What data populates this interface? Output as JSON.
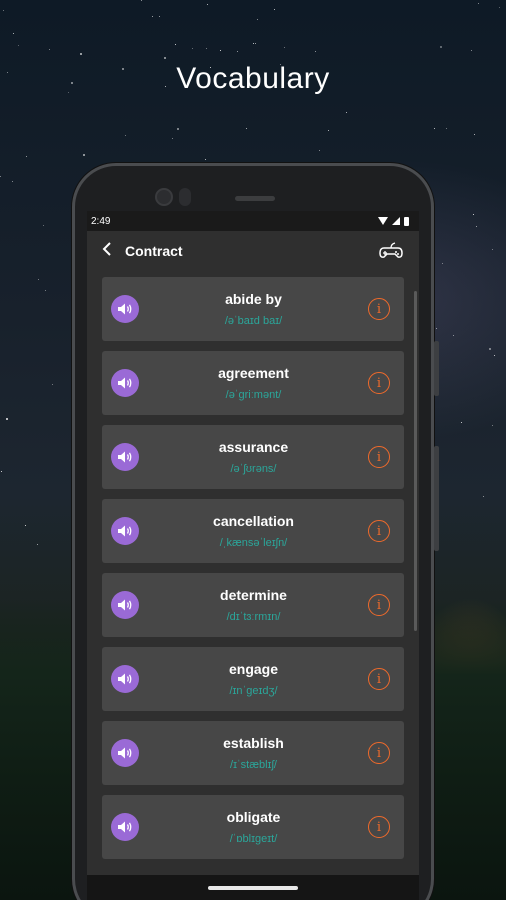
{
  "heading": "Vocabulary",
  "status": {
    "time": "2:49"
  },
  "appbar": {
    "back_icon": "chevron-left-icon",
    "title": "Contract",
    "game_icon": "gamepad-icon"
  },
  "colors": {
    "accent_purple": "#9a6ad6",
    "phonetic_teal": "#2ba69a",
    "info_orange": "#ef6a2b",
    "card_bg": "#474747"
  },
  "words": [
    {
      "word": "abide by",
      "phonetic": "/əˈbaɪd baɪ/"
    },
    {
      "word": "agreement",
      "phonetic": "/əˈɡriːmənt/"
    },
    {
      "word": "assurance",
      "phonetic": "/əˈʃʊrəns/"
    },
    {
      "word": "cancellation",
      "phonetic": "/ˌkænsəˈleɪʃn/"
    },
    {
      "word": "determine",
      "phonetic": "/dɪˈtɜːrmɪn/"
    },
    {
      "word": "engage",
      "phonetic": "/ɪnˈɡeɪdʒ/"
    },
    {
      "word": "establish",
      "phonetic": "/ɪˈstæblɪʃ/"
    },
    {
      "word": "obligate",
      "phonetic": "/ˈɒblɪɡeɪt/"
    }
  ]
}
